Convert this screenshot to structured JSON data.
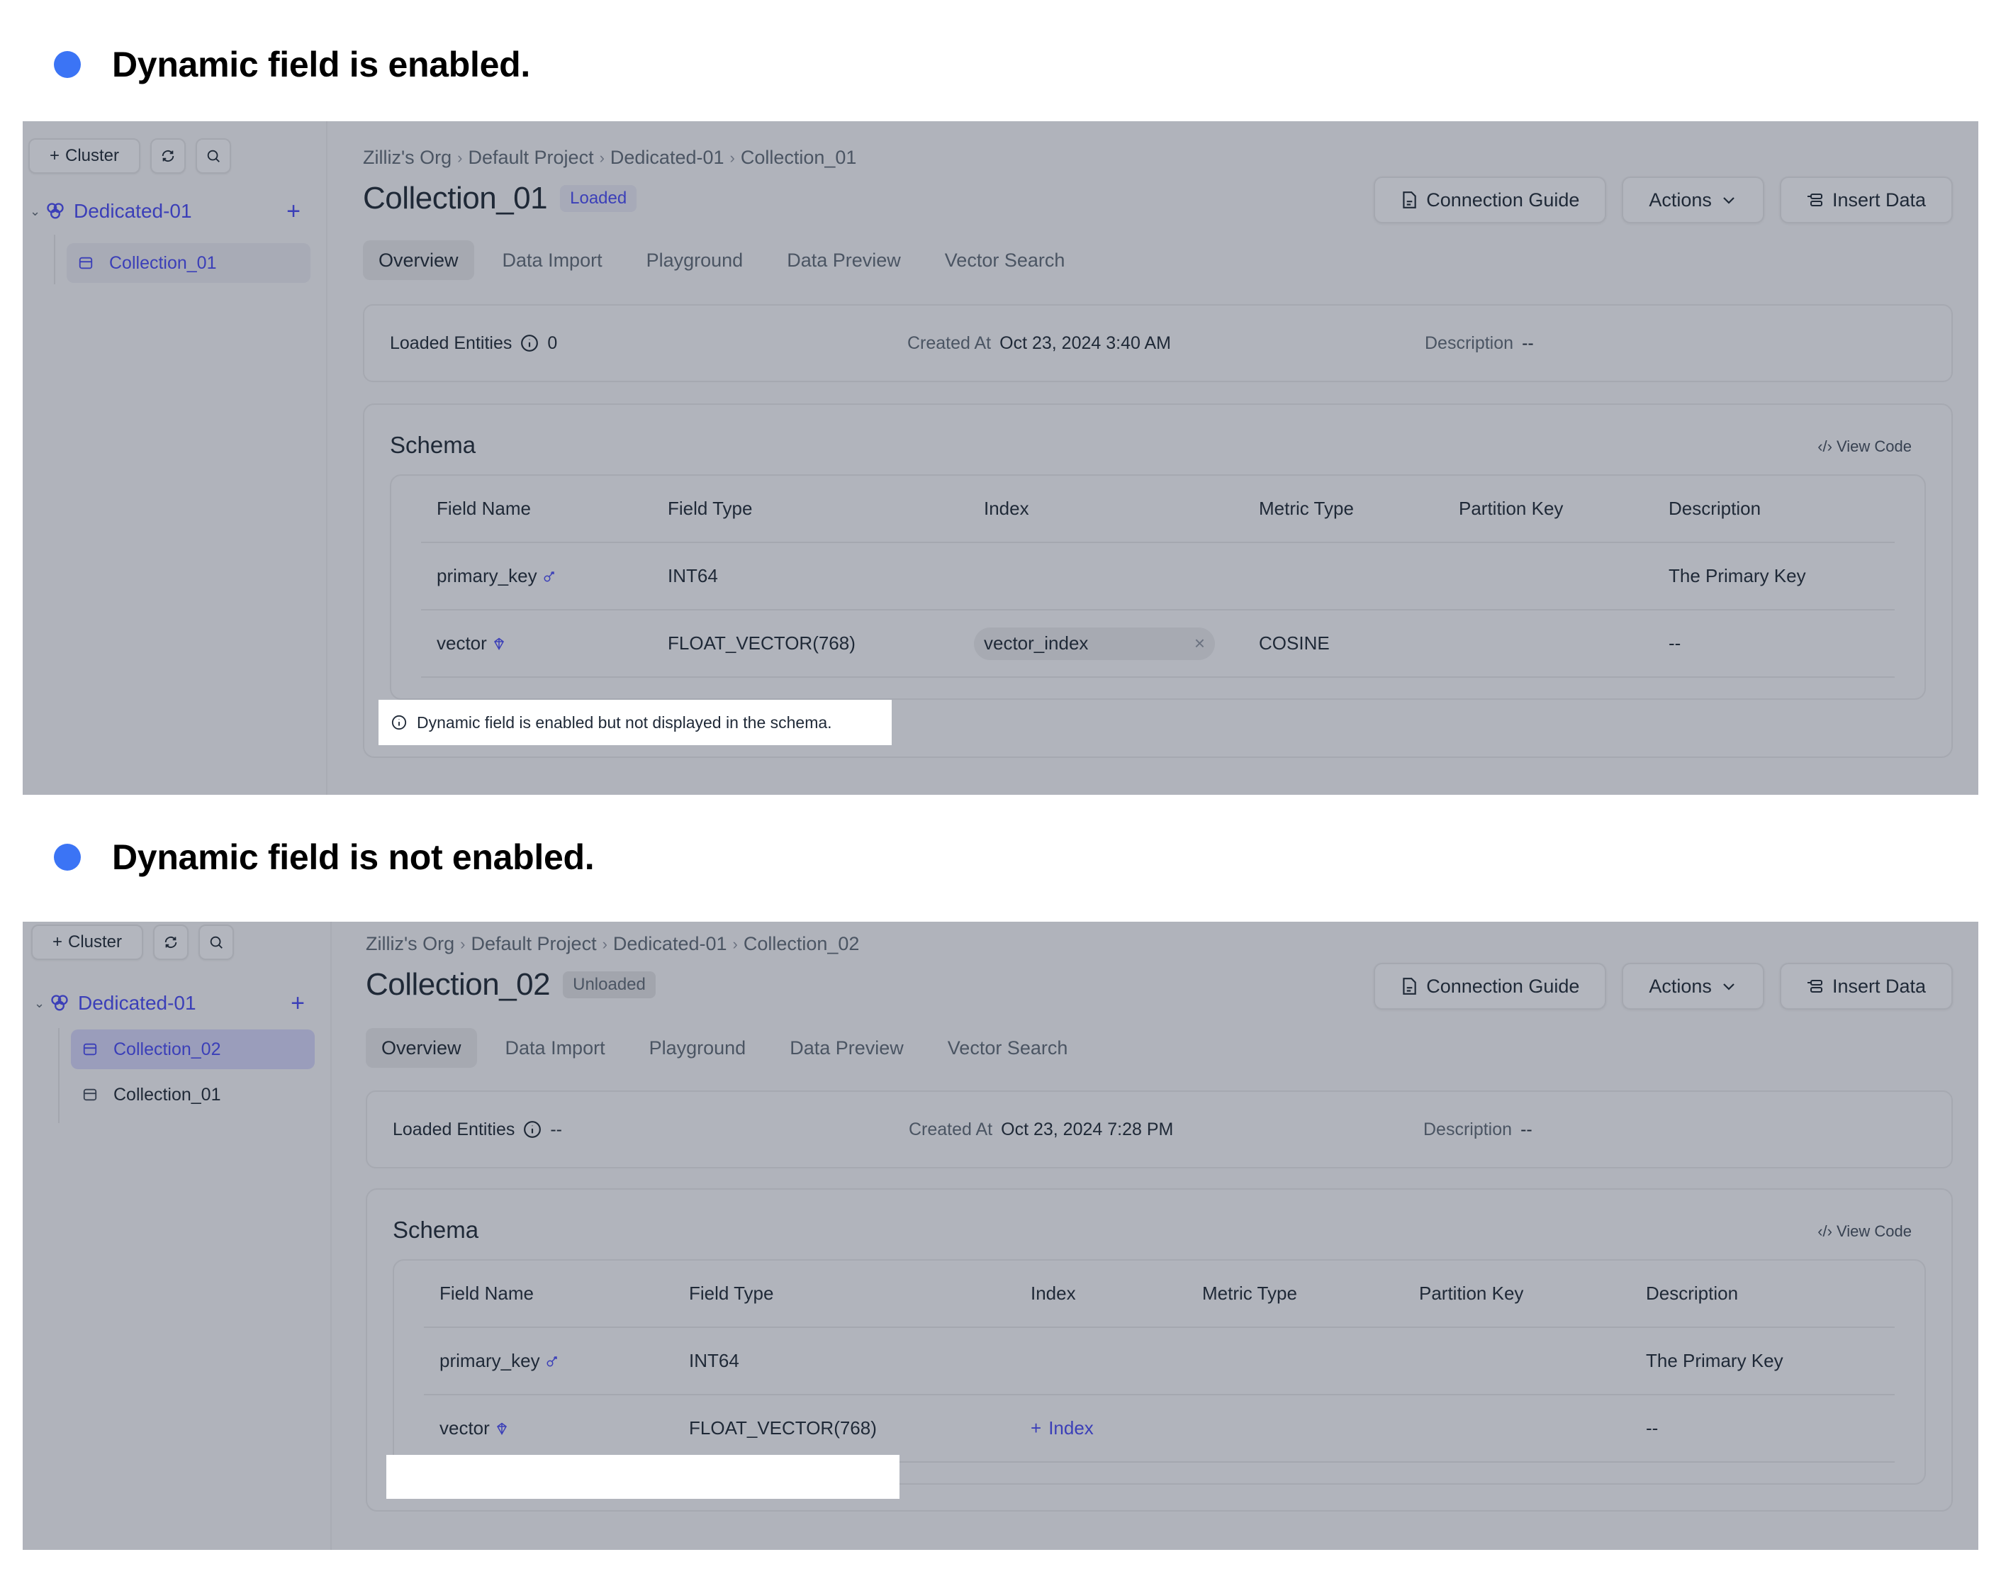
{
  "sections": [
    {
      "heading": "Dynamic field is enabled.",
      "sidebar": {
        "cluster_button": "Cluster",
        "refresh_icon": "refresh-icon",
        "search_icon": "search-icon",
        "tree_root": "Dedicated-01",
        "items": [
          {
            "label": "Collection_01",
            "state": "selected"
          }
        ]
      },
      "breadcrumb": [
        "Zilliz's Org",
        "Default Project",
        "Dedicated-01",
        "Collection_01"
      ],
      "title": "Collection_01",
      "status_badge": "Loaded",
      "actions": {
        "connection_guide": "Connection Guide",
        "actions": "Actions",
        "insert_data": "Insert Data"
      },
      "tabs": [
        "Overview",
        "Data Import",
        "Playground",
        "Data Preview",
        "Vector Search"
      ],
      "active_tab": "Overview",
      "info": {
        "loaded_entities_label": "Loaded Entities",
        "loaded_entities_value": "0",
        "created_at_label": "Created At",
        "created_at_value": "Oct 23, 2024 3:40 AM",
        "description_label": "Description",
        "description_value": "--"
      },
      "schema": {
        "title": "Schema",
        "view_code": "View Code",
        "columns": [
          "Field Name",
          "Field Type",
          "Index",
          "Metric Type",
          "Partition Key",
          "Description"
        ],
        "rows": [
          {
            "field_name": "primary_key",
            "field_icon": "key-icon",
            "field_type": "INT64",
            "index": "",
            "metric_type": "",
            "partition_key": "",
            "description": "The Primary Key"
          },
          {
            "field_name": "vector",
            "field_icon": "vector-icon",
            "field_type": "FLOAT_VECTOR(768)",
            "index": "vector_index",
            "metric_type": "COSINE",
            "partition_key": "",
            "description": "--"
          }
        ]
      },
      "note": "Dynamic field is enabled but not displayed in the schema."
    },
    {
      "heading": "Dynamic field is not enabled.",
      "sidebar": {
        "cluster_button": "Cluster",
        "refresh_icon": "refresh-icon",
        "search_icon": "search-icon",
        "tree_root": "Dedicated-01",
        "items": [
          {
            "label": "Collection_02",
            "state": "selected"
          },
          {
            "label": "Collection_01",
            "state": "normal"
          }
        ]
      },
      "breadcrumb": [
        "Zilliz's Org",
        "Default Project",
        "Dedicated-01",
        "Collection_02"
      ],
      "title": "Collection_02",
      "status_badge": "Unloaded",
      "actions": {
        "connection_guide": "Connection Guide",
        "actions": "Actions",
        "insert_data": "Insert Data"
      },
      "tabs": [
        "Overview",
        "Data Import",
        "Playground",
        "Data Preview",
        "Vector Search"
      ],
      "active_tab": "Overview",
      "info": {
        "loaded_entities_label": "Loaded Entities",
        "loaded_entities_value": "--",
        "created_at_label": "Created At",
        "created_at_value": "Oct 23, 2024 7:28 PM",
        "description_label": "Description",
        "description_value": "--"
      },
      "schema": {
        "title": "Schema",
        "view_code": "View Code",
        "columns": [
          "Field Name",
          "Field Type",
          "Index",
          "Metric Type",
          "Partition Key",
          "Description"
        ],
        "rows": [
          {
            "field_name": "primary_key",
            "field_icon": "key-icon",
            "field_type": "INT64",
            "index": "",
            "metric_type": "",
            "partition_key": "",
            "description": "The Primary Key"
          },
          {
            "field_name": "vector",
            "field_icon": "vector-icon",
            "field_type": "FLOAT_VECTOR(768)",
            "index_action": "Index",
            "metric_type": "",
            "partition_key": "",
            "description": "--"
          }
        ]
      }
    }
  ],
  "colors": {
    "bullet": "#3b74f5",
    "overlay": "#b0b3bb",
    "accent": "#3b3fb8"
  }
}
